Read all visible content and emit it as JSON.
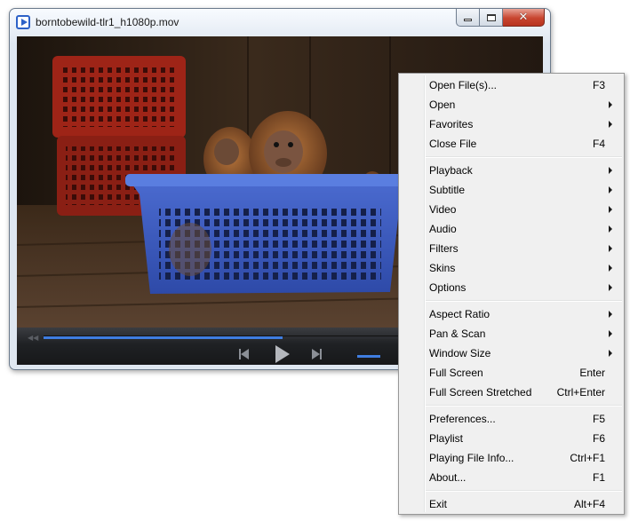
{
  "window": {
    "title": "borntobewild-tlr1_h1080p.mov",
    "icon": "player-app-icon",
    "controls": {
      "minimize_icon": "minimize-icon",
      "maximize_icon": "maximize-icon",
      "close_glyph": "✕"
    }
  },
  "player": {
    "video_description_icon": "video-frame",
    "seek_progress": 0.48,
    "volume_level": 0.25,
    "accent_color": "#3f7de0"
  },
  "context_menu": {
    "groups": [
      [
        {
          "label": "Open File(s)...",
          "shortcut": "F3",
          "submenu": false
        },
        {
          "label": "Open",
          "shortcut": "",
          "submenu": true
        },
        {
          "label": "Favorites",
          "shortcut": "",
          "submenu": true
        },
        {
          "label": "Close File",
          "shortcut": "F4",
          "submenu": false
        }
      ],
      [
        {
          "label": "Playback",
          "shortcut": "",
          "submenu": true
        },
        {
          "label": "Subtitle",
          "shortcut": "",
          "submenu": true
        },
        {
          "label": "Video",
          "shortcut": "",
          "submenu": true
        },
        {
          "label": "Audio",
          "shortcut": "",
          "submenu": true
        },
        {
          "label": "Filters",
          "shortcut": "",
          "submenu": true
        },
        {
          "label": "Skins",
          "shortcut": "",
          "submenu": true
        },
        {
          "label": "Options",
          "shortcut": "",
          "submenu": true
        }
      ],
      [
        {
          "label": "Aspect Ratio",
          "shortcut": "",
          "submenu": true
        },
        {
          "label": "Pan & Scan",
          "shortcut": "",
          "submenu": true
        },
        {
          "label": "Window Size",
          "shortcut": "",
          "submenu": true
        },
        {
          "label": "Full Screen",
          "shortcut": "Enter",
          "submenu": false
        },
        {
          "label": "Full Screen Stretched",
          "shortcut": "Ctrl+Enter",
          "submenu": false
        }
      ],
      [
        {
          "label": "Preferences...",
          "shortcut": "F5",
          "submenu": false
        },
        {
          "label": "Playlist",
          "shortcut": "F6",
          "submenu": false
        },
        {
          "label": "Playing File Info...",
          "shortcut": "Ctrl+F1",
          "submenu": false
        },
        {
          "label": "About...",
          "shortcut": "F1",
          "submenu": false
        }
      ],
      [
        {
          "label": "Exit",
          "shortcut": "Alt+F4",
          "submenu": false
        }
      ]
    ]
  }
}
